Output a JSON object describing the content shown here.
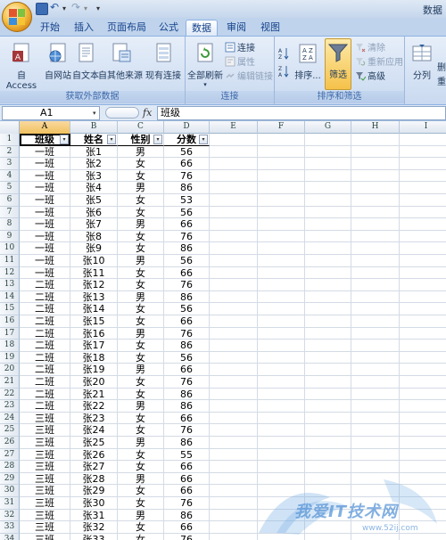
{
  "window": {
    "title_fragment": "数据"
  },
  "tabs": [
    {
      "label": "开始",
      "active": false
    },
    {
      "label": "插入",
      "active": false
    },
    {
      "label": "页面布局",
      "active": false
    },
    {
      "label": "公式",
      "active": false
    },
    {
      "label": "数据",
      "active": true
    },
    {
      "label": "审阅",
      "active": false
    },
    {
      "label": "视图",
      "active": false
    }
  ],
  "ribbon": {
    "external_data": {
      "label": "获取外部数据",
      "from_access": "自 Access",
      "from_web": "自网站",
      "from_text": "自文本",
      "from_other": "自其他来源",
      "existing": "现有连接"
    },
    "connections": {
      "label": "连接",
      "refresh_all": "全部刷新",
      "connections": "连接",
      "properties": "属性",
      "edit_links": "编辑链接"
    },
    "sort_filter": {
      "label": "排序和筛选",
      "sort": "排序...",
      "filter": "筛选",
      "clear": "清除",
      "reapply": "重新应用",
      "advanced": "高级"
    },
    "tools": {
      "split": "分列",
      "partial_1": "删",
      "partial_2": "重"
    }
  },
  "formula_bar": {
    "name_box": "A1",
    "fx": "fx",
    "value": "班级"
  },
  "columns": [
    "A",
    "B",
    "C",
    "D",
    "E",
    "F",
    "G",
    "H",
    "I"
  ],
  "table": {
    "headers": [
      "班级",
      "姓名",
      "性别",
      "分数"
    ],
    "rows": [
      [
        "一班",
        "张1",
        "男",
        "56"
      ],
      [
        "一班",
        "张2",
        "女",
        "66"
      ],
      [
        "一班",
        "张3",
        "女",
        "76"
      ],
      [
        "一班",
        "张4",
        "男",
        "86"
      ],
      [
        "一班",
        "张5",
        "女",
        "53"
      ],
      [
        "一班",
        "张6",
        "女",
        "56"
      ],
      [
        "一班",
        "张7",
        "男",
        "66"
      ],
      [
        "一班",
        "张8",
        "女",
        "76"
      ],
      [
        "一班",
        "张9",
        "女",
        "86"
      ],
      [
        "一班",
        "张10",
        "男",
        "56"
      ],
      [
        "一班",
        "张11",
        "女",
        "66"
      ],
      [
        "二班",
        "张12",
        "女",
        "76"
      ],
      [
        "二班",
        "张13",
        "男",
        "86"
      ],
      [
        "二班",
        "张14",
        "女",
        "56"
      ],
      [
        "二班",
        "张15",
        "女",
        "66"
      ],
      [
        "二班",
        "张16",
        "男",
        "76"
      ],
      [
        "二班",
        "张17",
        "女",
        "86"
      ],
      [
        "二班",
        "张18",
        "女",
        "56"
      ],
      [
        "二班",
        "张19",
        "男",
        "66"
      ],
      [
        "二班",
        "张20",
        "女",
        "76"
      ],
      [
        "二班",
        "张21",
        "女",
        "86"
      ],
      [
        "二班",
        "张22",
        "男",
        "86"
      ],
      [
        "三班",
        "张23",
        "女",
        "66"
      ],
      [
        "三班",
        "张24",
        "女",
        "76"
      ],
      [
        "三班",
        "张25",
        "男",
        "86"
      ],
      [
        "三班",
        "张26",
        "女",
        "55"
      ],
      [
        "三班",
        "张27",
        "女",
        "66"
      ],
      [
        "三班",
        "张28",
        "男",
        "66"
      ],
      [
        "三班",
        "张29",
        "女",
        "66"
      ],
      [
        "三班",
        "张30",
        "女",
        "76"
      ],
      [
        "三班",
        "张31",
        "男",
        "86"
      ],
      [
        "三班",
        "张32",
        "女",
        "66"
      ],
      [
        "三班",
        "张33",
        "女",
        "76"
      ]
    ]
  },
  "watermark": {
    "text": "我爱IT技术网",
    "url": "www.52ij.com"
  },
  "colors": {
    "accent": "#15428b",
    "selected_header": "#f1c15f",
    "filter_active": "#f5c24a"
  }
}
